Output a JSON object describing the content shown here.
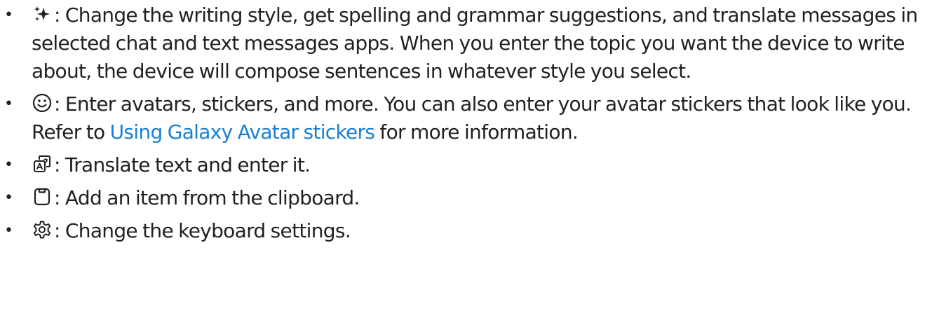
{
  "colors": {
    "text": "#231f20",
    "link": "#1a7fd4"
  },
  "items": [
    {
      "icon": "sparkle-icon",
      "text": ": Change the writing style, get spelling and grammar suggestions, and translate messages in selected chat and text messages apps. When you enter the topic you want the device to write about, the device will compose sentences in whatever style you select."
    },
    {
      "icon": "smiley-icon",
      "text_before": ": Enter avatars, stickers, and more. You can also enter your avatar stickers that look like you. Refer to ",
      "link": "Using Galaxy Avatar stickers",
      "text_after": " for more information."
    },
    {
      "icon": "translate-icon",
      "text": ": Translate text and enter it."
    },
    {
      "icon": "clipboard-icon",
      "text": ": Add an item from the clipboard."
    },
    {
      "icon": "gear-icon",
      "text": ": Change the keyboard settings."
    }
  ]
}
